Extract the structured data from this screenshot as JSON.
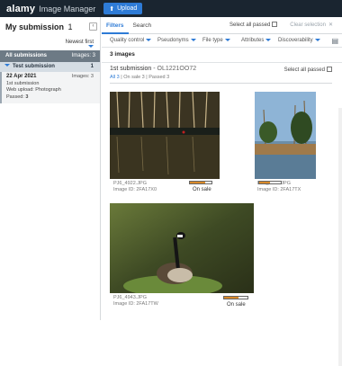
{
  "topbar": {
    "logo": "alamy",
    "app_name": "Image Manager",
    "upload_label": "Upload"
  },
  "left_panel": {
    "title": "My submission",
    "title_count": "1",
    "collapse_icon": "circle-arrow-left",
    "sort_label": "Newest first",
    "all_submissions": {
      "label": "All submissions",
      "images": "Images: 3"
    },
    "test_submission": {
      "label": "Test submission",
      "count": "1"
    },
    "submission": {
      "date": "22 Apr 2021",
      "images": "Images: 3",
      "name": "1st submission",
      "upload": "Web upload: Photograph",
      "passed_label": "Passed:",
      "passed_value": "3"
    }
  },
  "tabs": {
    "filters": "Filters",
    "search": "Search",
    "select_all": "Select all passed",
    "clear": "Clear selection"
  },
  "filters": [
    "Quality control",
    "Pseudonyms",
    "File type",
    "Attributes",
    "Discoverability"
  ],
  "image_count": "3 images",
  "header": {
    "title": "1st submission",
    "id": "- OL1221OO72",
    "select_all": "Select all passed",
    "all": "All 3",
    "on_sale": "On sale 3",
    "passed": "Passed 3"
  },
  "images": [
    {
      "file": "PJ6_4922.JPG",
      "id": "Image ID: 2FA17X0",
      "status": "On sale",
      "quality": 0.7
    },
    {
      "file": "PJ6_4942.JPG",
      "id": "Image ID: 2FA17TX",
      "status": "",
      "quality": 0.5
    },
    {
      "file": "PJ6_4943.JPG",
      "id": "Image ID: 2FA17TW",
      "status": "On sale",
      "quality": 0.6
    }
  ],
  "colors": {
    "accent": "#2e7bd6",
    "topbar": "#1a2530",
    "quality_bar": "#d98a2b"
  }
}
